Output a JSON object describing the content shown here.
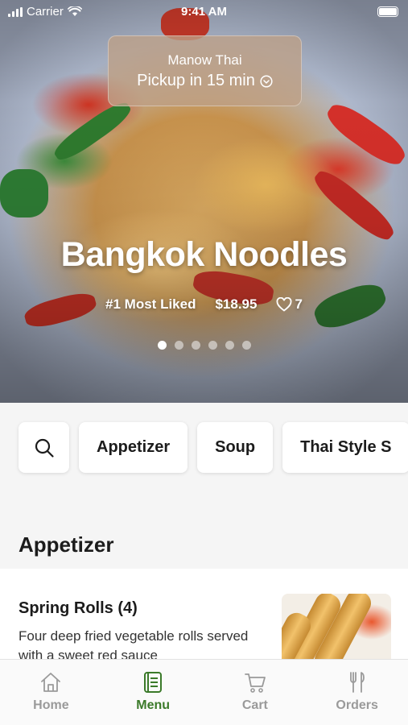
{
  "status_bar": {
    "carrier": "Carrier",
    "time": "9:41 AM"
  },
  "pickup": {
    "restaurant": "Manow Thai",
    "eta": "Pickup in 15 min"
  },
  "featured": {
    "title": "Bangkok Noodles",
    "badge": "#1 Most Liked",
    "price": "$18.95",
    "likes": "7",
    "slide_count": 6,
    "active_slide": 1
  },
  "categories": [
    {
      "label": "Appetizer"
    },
    {
      "label": "Soup"
    },
    {
      "label": "Thai Style S"
    }
  ],
  "section": {
    "title": "Appetizer"
  },
  "item": {
    "name": "Spring Rolls (4)",
    "description": "Four deep fried vegetable rolls served with a sweet red sauce"
  },
  "tabs": [
    {
      "label": "Home",
      "icon": "home-icon",
      "active": false
    },
    {
      "label": "Menu",
      "icon": "menu-icon",
      "active": true
    },
    {
      "label": "Cart",
      "icon": "cart-icon",
      "active": false
    },
    {
      "label": "Orders",
      "icon": "fork-knife-icon",
      "active": false
    }
  ],
  "colors": {
    "accent": "#3b7a2a",
    "inactive": "#9a9a9a"
  }
}
